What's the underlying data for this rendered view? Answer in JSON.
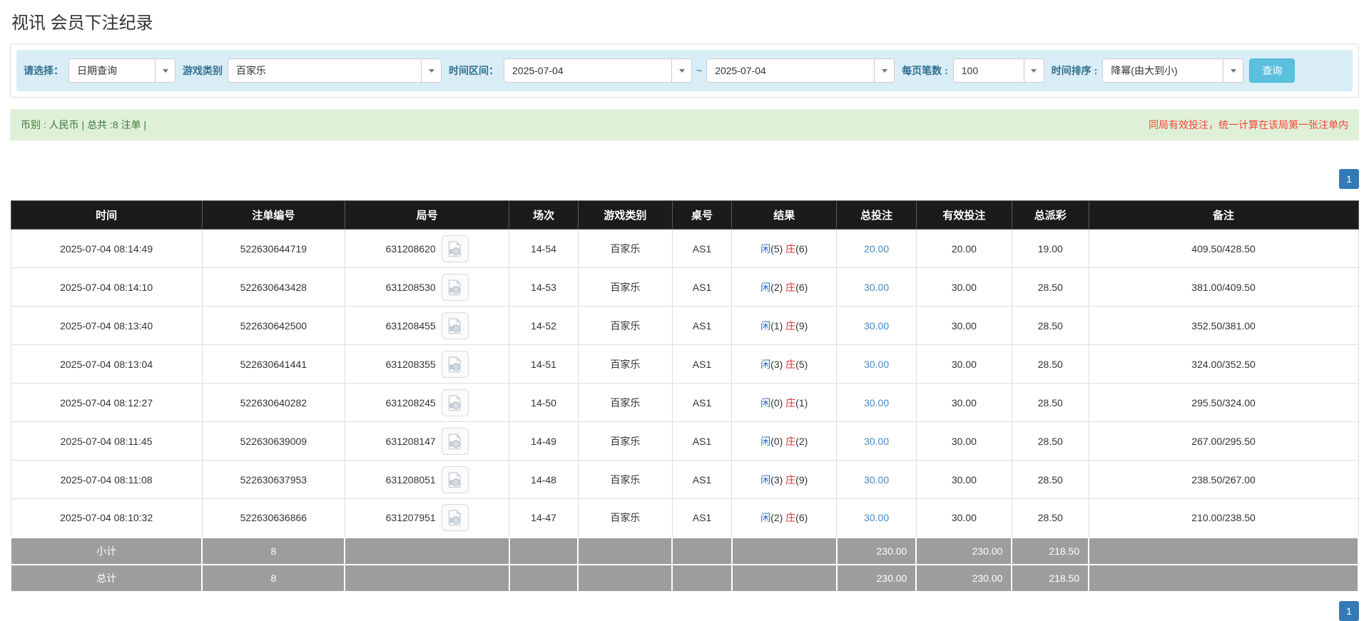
{
  "page": {
    "title": "视讯 会员下注纪录"
  },
  "filters": {
    "select_label": "请选择：",
    "select_value": "日期查询",
    "game_type_label": "游戏类别",
    "game_type_value": "百家乐",
    "time_range_label": "时间区间：",
    "date_from": "2025-07-04",
    "tilde": "~",
    "date_to": "2025-07-04",
    "page_size_label": "每页笔数 :",
    "page_size_value": "100",
    "sort_label": "时间排序 :",
    "sort_value": "降幂(由大到小)",
    "query_button": "查询"
  },
  "summary": {
    "left_text": "币别 : 人民币 | 总共 :8 注单 |",
    "right_notice": "同局有效投注，统一计算在该局第一张注单内"
  },
  "pagination": {
    "page": "1"
  },
  "icons": {
    "video_icon": "video-replay-icon",
    "dropdown_icon": "chevron-down-icon"
  },
  "colors": {
    "filter_bg": "#d9edf7",
    "filter_label": "#31708f",
    "query_button": "#5bc0de",
    "summary_bg": "#dff0d8",
    "summary_text": "#3c763d",
    "notice_red": "#f44336",
    "header_bg": "#1b1b1b",
    "link_blue": "#428bca",
    "player_blue": "#3366cc",
    "banker_red": "#dd3333",
    "totals_gray": "#9d9d9d",
    "pagination_blue": "#337ab7"
  },
  "table": {
    "headers": [
      "时间",
      "注单编号",
      "局号",
      "场次",
      "游戏类别",
      "桌号",
      "结果",
      "总投注",
      "有效投注",
      "总派彩",
      "备注"
    ],
    "rows": [
      {
        "time": "2025-07-04 08:14:49",
        "bet_id": "522630644719",
        "round_id": "631208620",
        "session": "14-54",
        "game": "百家乐",
        "table_no": "AS1",
        "result": {
          "player": "闲",
          "player_n": "(5)",
          "banker": "庄",
          "banker_n": "(6)"
        },
        "total_bet": "20.00",
        "valid_bet": "20.00",
        "payout": "19.00",
        "remark": "409.50/428.50"
      },
      {
        "time": "2025-07-04 08:14:10",
        "bet_id": "522630643428",
        "round_id": "631208530",
        "session": "14-53",
        "game": "百家乐",
        "table_no": "AS1",
        "result": {
          "player": "闲",
          "player_n": "(2)",
          "banker": "庄",
          "banker_n": "(6)"
        },
        "total_bet": "30.00",
        "valid_bet": "30.00",
        "payout": "28.50",
        "remark": "381.00/409.50"
      },
      {
        "time": "2025-07-04 08:13:40",
        "bet_id": "522630642500",
        "round_id": "631208455",
        "session": "14-52",
        "game": "百家乐",
        "table_no": "AS1",
        "result": {
          "player": "闲",
          "player_n": "(1)",
          "banker": "庄",
          "banker_n": "(9)"
        },
        "total_bet": "30.00",
        "valid_bet": "30.00",
        "payout": "28.50",
        "remark": "352.50/381.00"
      },
      {
        "time": "2025-07-04 08:13:04",
        "bet_id": "522630641441",
        "round_id": "631208355",
        "session": "14-51",
        "game": "百家乐",
        "table_no": "AS1",
        "result": {
          "player": "闲",
          "player_n": "(3)",
          "banker": "庄",
          "banker_n": "(5)"
        },
        "total_bet": "30.00",
        "valid_bet": "30.00",
        "payout": "28.50",
        "remark": "324.00/352.50"
      },
      {
        "time": "2025-07-04 08:12:27",
        "bet_id": "522630640282",
        "round_id": "631208245",
        "session": "14-50",
        "game": "百家乐",
        "table_no": "AS1",
        "result": {
          "player": "闲",
          "player_n": "(0)",
          "banker": "庄",
          "banker_n": "(1)"
        },
        "total_bet": "30.00",
        "valid_bet": "30.00",
        "payout": "28.50",
        "remark": "295.50/324.00"
      },
      {
        "time": "2025-07-04 08:11:45",
        "bet_id": "522630639009",
        "round_id": "631208147",
        "session": "14-49",
        "game": "百家乐",
        "table_no": "AS1",
        "result": {
          "player": "闲",
          "player_n": "(0)",
          "banker": "庄",
          "banker_n": "(2)"
        },
        "total_bet": "30.00",
        "valid_bet": "30.00",
        "payout": "28.50",
        "remark": "267.00/295.50"
      },
      {
        "time": "2025-07-04 08:11:08",
        "bet_id": "522630637953",
        "round_id": "631208051",
        "session": "14-48",
        "game": "百家乐",
        "table_no": "AS1",
        "result": {
          "player": "闲",
          "player_n": "(3)",
          "banker": "庄",
          "banker_n": "(9)"
        },
        "total_bet": "30.00",
        "valid_bet": "30.00",
        "payout": "28.50",
        "remark": "238.50/267.00"
      },
      {
        "time": "2025-07-04 08:10:32",
        "bet_id": "522630636866",
        "round_id": "631207951",
        "session": "14-47",
        "game": "百家乐",
        "table_no": "AS1",
        "result": {
          "player": "闲",
          "player_n": "(2)",
          "banker": "庄",
          "banker_n": "(6)"
        },
        "total_bet": "30.00",
        "valid_bet": "30.00",
        "payout": "28.50",
        "remark": "210.00/238.50"
      }
    ],
    "subtotal": {
      "label": "小计",
      "count": "8",
      "total_bet": "230.00",
      "valid_bet": "230.00",
      "payout": "218.50"
    },
    "total": {
      "label": "总计",
      "count": "8",
      "total_bet": "230.00",
      "valid_bet": "230.00",
      "payout": "218.50"
    }
  }
}
